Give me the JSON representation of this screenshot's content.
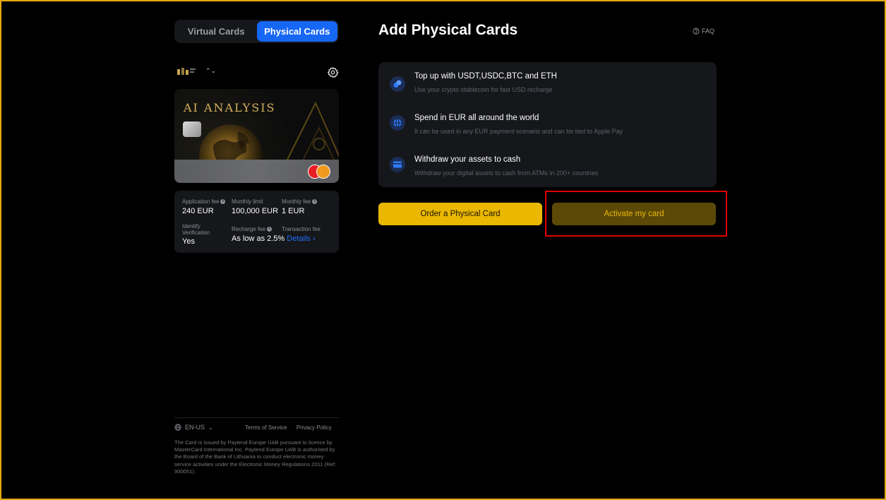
{
  "tabs": {
    "virtual": "Virtual Cards",
    "physical": "Physical Cards",
    "active": "physical"
  },
  "card": {
    "brand_text": "AI ANALYSIS"
  },
  "fees": {
    "application_fee_label": "Application fee",
    "application_fee_value": "240 EUR",
    "monthly_limit_label": "Monthly limit",
    "monthly_limit_value": "100,000 EUR",
    "monthly_fee_label": "Monthly fee",
    "monthly_fee_value": "1 EUR",
    "identify_label_1": "Identify",
    "identify_label_2": "Verification",
    "identify_value": "Yes",
    "recharge_fee_label": "Recharge fee",
    "transaction_fee_label": "Transaction fee",
    "rate_value": "As low as 2.5%",
    "details_link": "Details ›"
  },
  "footer": {
    "language": "EN-US",
    "terms": "Terms of Service",
    "privacy": "Privacy Policy",
    "disclaimer": "The Card is issued by Paytend Europe UAB pursuant to licence by MasterCard International Inc. Paytend Europe UAB is authorised by the Board of the Bank of Lithuania to conduct electronic money service activities under the Electronic Money Regulations 2011 (Ref: 900051)."
  },
  "main": {
    "title": "Add Physical Cards",
    "faq": "FAQ",
    "features": [
      {
        "title": "Top up with USDT,USDC,BTC and ETH",
        "desc": "Use your crypto stablecoin for fast USD recharge",
        "icon": "coins-icon"
      },
      {
        "title": "Spend in EUR all around the world",
        "desc": "It can be used in any EUR payment scenario and can be tied to Apple Pay",
        "icon": "globe-icon"
      },
      {
        "title": "Withdraw your assets to cash",
        "desc": "Withdraw your digital assets to cash from ATMs in 200+ countries",
        "icon": "card-icon"
      }
    ],
    "order_button": "Order a Physical Card",
    "activate_button": "Activate my card"
  },
  "colors": {
    "accent_blue": "#1767f5",
    "accent_yellow": "#eab800",
    "frame_border": "#e3a812",
    "highlight_box": "#e00000"
  }
}
